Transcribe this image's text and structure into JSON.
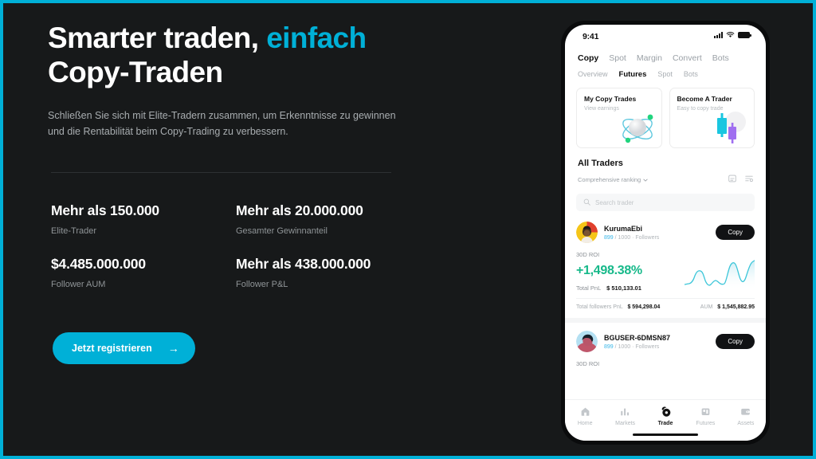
{
  "theme": {
    "frame_accent": "#00b0d7",
    "background": "#17191a",
    "cta_color": "#00b0d7",
    "positive_green": "#17b98a",
    "link_blue": "#38b6e8"
  },
  "hero": {
    "headline_part1": "Smarter traden,",
    "headline_accent": "einfach",
    "headline_part2": "Copy-Traden",
    "subhead": "Schließen Sie sich mit Elite-Tradern zusammen, um Erkenntnisse zu gewinnen und die Rentabilität beim Copy-Trading zu verbessern.",
    "cta_label": "Jetzt registrieren",
    "cta_arrow": "arrow-right-icon"
  },
  "stats": [
    {
      "value": "Mehr als 150.000",
      "label": "Elite-Trader"
    },
    {
      "value": "Mehr als 20.000.000",
      "label": "Gesamter Gewinnanteil"
    },
    {
      "value": "$4.485.000.000",
      "label": "Follower AUM"
    },
    {
      "value": "Mehr als 438.000.000",
      "label": "Follower P&L"
    }
  ],
  "phone": {
    "statusbar": {
      "time": "9:41",
      "icons": [
        "cellular-signal-icon",
        "wifi-icon",
        "battery-icon"
      ]
    },
    "top_tabs": [
      {
        "label": "Copy",
        "active": true
      },
      {
        "label": "Spot",
        "active": false
      },
      {
        "label": "Margin",
        "active": false
      },
      {
        "label": "Convert",
        "active": false
      },
      {
        "label": "Bots",
        "active": false
      }
    ],
    "sub_tabs": [
      {
        "label": "Overview",
        "active": false
      },
      {
        "label": "Futures",
        "active": true
      },
      {
        "label": "Spot",
        "active": false
      },
      {
        "label": "Bots",
        "active": false
      }
    ],
    "promos": [
      {
        "title": "My Copy Trades",
        "subtitle": "View earnings",
        "art": "atom-orbit-icon"
      },
      {
        "title": "Become A Trader",
        "subtitle": "Easy to copy trade",
        "art": "candlestick-icon"
      }
    ],
    "section": {
      "title": "All Traders",
      "ranking_label": "Comprehensive ranking",
      "ranking_caret": "chevron-down-icon",
      "icons": [
        "checklist-icon",
        "filter-icon"
      ],
      "search_placeholder": "Search trader",
      "search_value": "",
      "search_icon": "search-icon"
    },
    "traders": [
      {
        "name": "KurumaEbi",
        "followers_current": "899",
        "followers_divider": "/ 1000",
        "followers_word": "· Followers",
        "copy_label": "Copy",
        "roi_label": "30D ROI",
        "roi_value": "+1,498.38%",
        "pnl_label": "Total PnL",
        "pnl_value": "$ 510,133.01",
        "followers_pnl_label": "Total followers PnL",
        "followers_pnl_value": "$ 594,298.04",
        "aum_label": "AUM",
        "aum_value": "$ 1,545,882.95"
      },
      {
        "name": "BGUSER-6DMSN87",
        "followers_current": "899",
        "followers_divider": "/ 1000",
        "followers_word": "· Followers",
        "copy_label": "Copy",
        "roi_label": "30D ROI"
      }
    ],
    "bottom_nav": [
      {
        "label": "Home",
        "icon": "home-icon",
        "active": false
      },
      {
        "label": "Markets",
        "icon": "bars-chart-icon",
        "active": false
      },
      {
        "label": "Trade",
        "icon": "trade-icon",
        "active": true
      },
      {
        "label": "Futures",
        "icon": "futures-icon",
        "active": false
      },
      {
        "label": "Assets",
        "icon": "wallet-icon",
        "active": false
      }
    ]
  },
  "chart_data": {
    "type": "area",
    "title": "30D ROI sparkline",
    "x": [
      0,
      1,
      2,
      3,
      4,
      5,
      6,
      7,
      8,
      9,
      10,
      11,
      12,
      13,
      14,
      15,
      16
    ],
    "values": [
      18,
      20,
      30,
      52,
      48,
      26,
      22,
      34,
      30,
      24,
      23,
      58,
      86,
      52,
      26,
      74,
      88
    ],
    "series": [
      {
        "name": "30D ROI",
        "values": [
          18,
          20,
          30,
          52,
          48,
          26,
          22,
          34,
          30,
          24,
          23,
          58,
          86,
          52,
          26,
          74,
          88
        ]
      }
    ],
    "xlabel": "",
    "ylabel": "",
    "ylim": [
      0,
      100
    ],
    "grid": false,
    "legend": "none",
    "line_color": "#3cc6d9",
    "fill_gradient": [
      "#bfe7f0",
      "#ffffff"
    ]
  }
}
